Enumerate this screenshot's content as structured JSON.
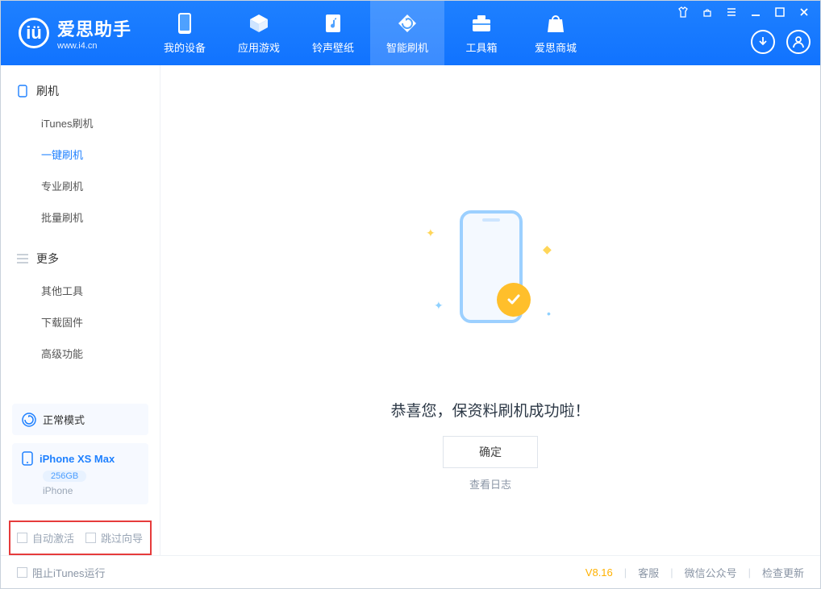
{
  "app": {
    "name_cn": "爱思助手",
    "name_en": "www.i4.cn"
  },
  "nav": {
    "items": [
      {
        "label": "我的设备"
      },
      {
        "label": "应用游戏"
      },
      {
        "label": "铃声壁纸"
      },
      {
        "label": "智能刷机",
        "active": true
      },
      {
        "label": "工具箱"
      },
      {
        "label": "爱思商城"
      }
    ]
  },
  "sidebar": {
    "section1": {
      "title": "刷机",
      "items": [
        {
          "label": "iTunes刷机"
        },
        {
          "label": "一键刷机",
          "active": true
        },
        {
          "label": "专业刷机"
        },
        {
          "label": "批量刷机"
        }
      ]
    },
    "section2": {
      "title": "更多",
      "items": [
        {
          "label": "其他工具"
        },
        {
          "label": "下载固件"
        },
        {
          "label": "高级功能"
        }
      ]
    },
    "mode_block": {
      "label": "正常模式"
    },
    "device_block": {
      "name": "iPhone XS Max",
      "storage": "256GB",
      "type": "iPhone"
    },
    "checkboxes": {
      "auto_activate": "自动激活",
      "skip_guide": "跳过向导"
    }
  },
  "main": {
    "message": "恭喜您，保资料刷机成功啦！",
    "ok_label": "确定",
    "log_label": "查看日志"
  },
  "footer": {
    "block_itunes": "阻止iTunes运行",
    "version": "V8.16",
    "links": {
      "support": "客服",
      "wechat": "微信公众号",
      "update": "检查更新"
    }
  }
}
